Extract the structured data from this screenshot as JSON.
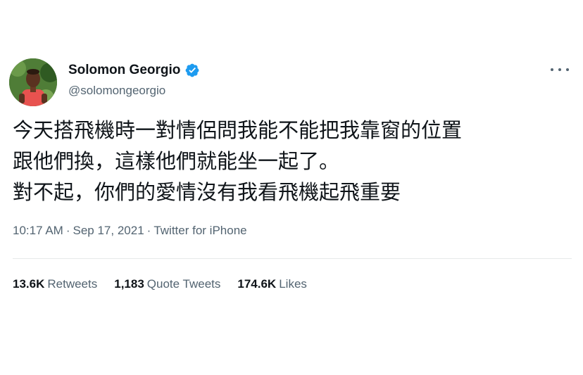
{
  "author": {
    "display_name": "Solomon Georgio",
    "handle": "@solomongeorgio",
    "verified": true,
    "avatar_icon": "profile-photo"
  },
  "menu": {
    "icon": "more-horizontal-icon"
  },
  "tweet": {
    "lines": [
      "今天搭飛機時一對情侶問我能不能把我靠窗的位置",
      "跟他們換，這樣他們就能坐一起了。",
      "對不起，你們的愛情沒有我看飛機起飛重要"
    ]
  },
  "meta": {
    "time": "10:17 AM",
    "separator": "·",
    "date": "Sep 17, 2021",
    "source": "Twitter for iPhone"
  },
  "stats": {
    "retweets": {
      "value": "13.6K",
      "label": "Retweets"
    },
    "quotes": {
      "value": "1,183",
      "label": "Quote Tweets"
    },
    "likes": {
      "value": "174.6K",
      "label": "Likes"
    }
  },
  "colors": {
    "text": "#0f1419",
    "secondary": "#536471",
    "verified": "#1d9bf0",
    "divider": "#e7e9ea"
  }
}
